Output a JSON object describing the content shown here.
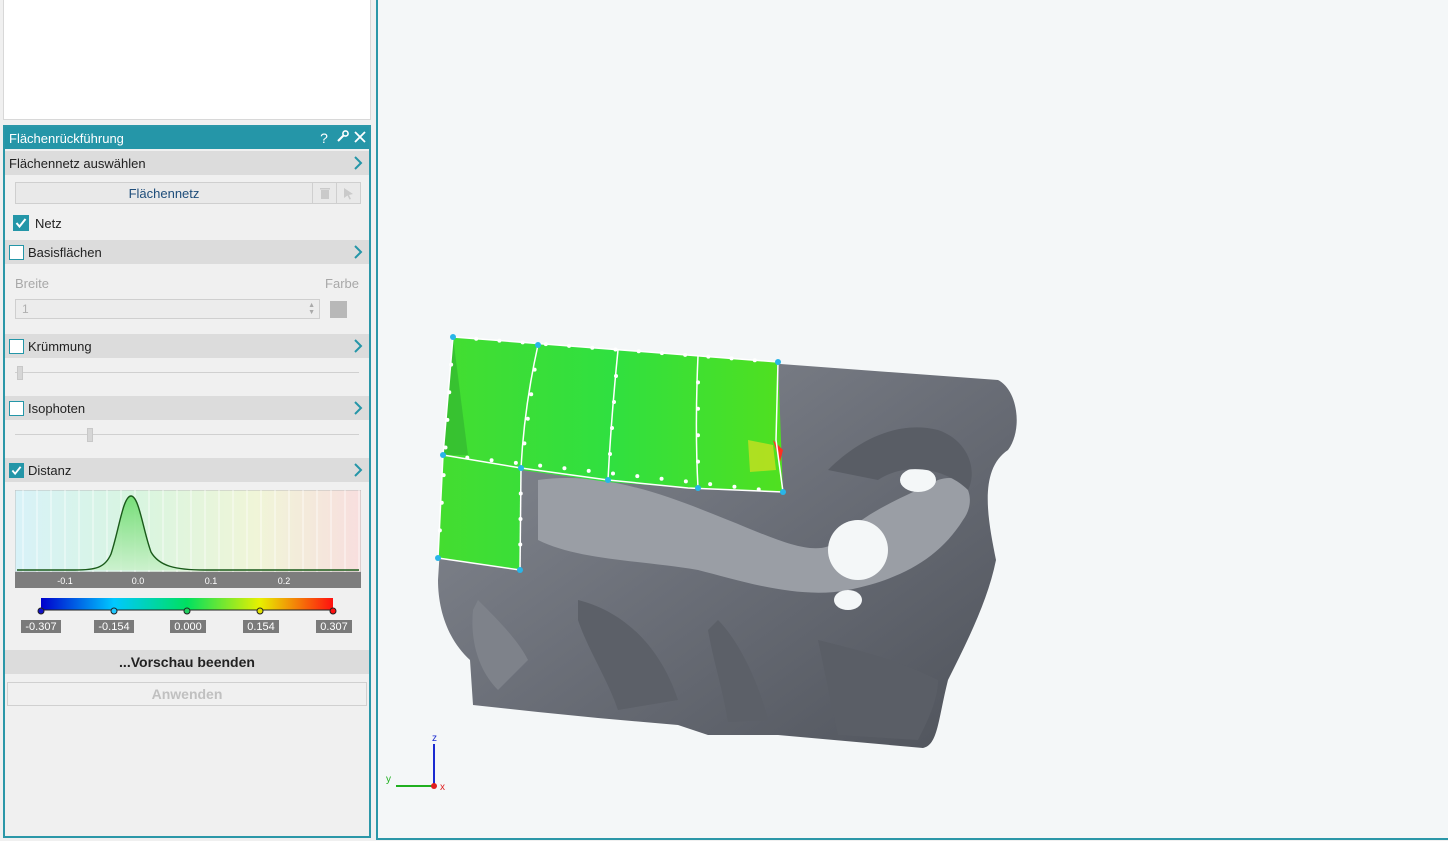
{
  "panel": {
    "title": "Flächenrückführung",
    "help_icon": "question-icon",
    "pin_icon": "wrench-icon",
    "close_icon": "close-icon",
    "select_mesh_label": "Flächennetz auswählen",
    "mesh_button_label": "Flächennetz",
    "netz_label": "Netz",
    "netz_checked": true,
    "basis_label": "Basisflächen",
    "basis_checked": false,
    "breite_label": "Breite",
    "farbe_label": "Farbe",
    "breite_value": "1",
    "kruemmung_label": "Krümmung",
    "kruemmung_checked": false,
    "isophoten_label": "Isophoten",
    "isophoten_checked": false,
    "distanz_label": "Distanz",
    "distanz_checked": true,
    "preview_label": "...Vorschau beenden",
    "apply_label": "Anwenden",
    "accent_color": "#2596a8"
  },
  "histogram": {
    "x_ticks": [
      "-0.1",
      "0.0",
      "0.1",
      "0.2"
    ]
  },
  "colormap": {
    "stops": [
      "-0.307",
      "-0.154",
      "0.000",
      "0.154",
      "0.307"
    ]
  },
  "axes_triad": {
    "z": "z",
    "y": "y",
    "x": "x"
  }
}
